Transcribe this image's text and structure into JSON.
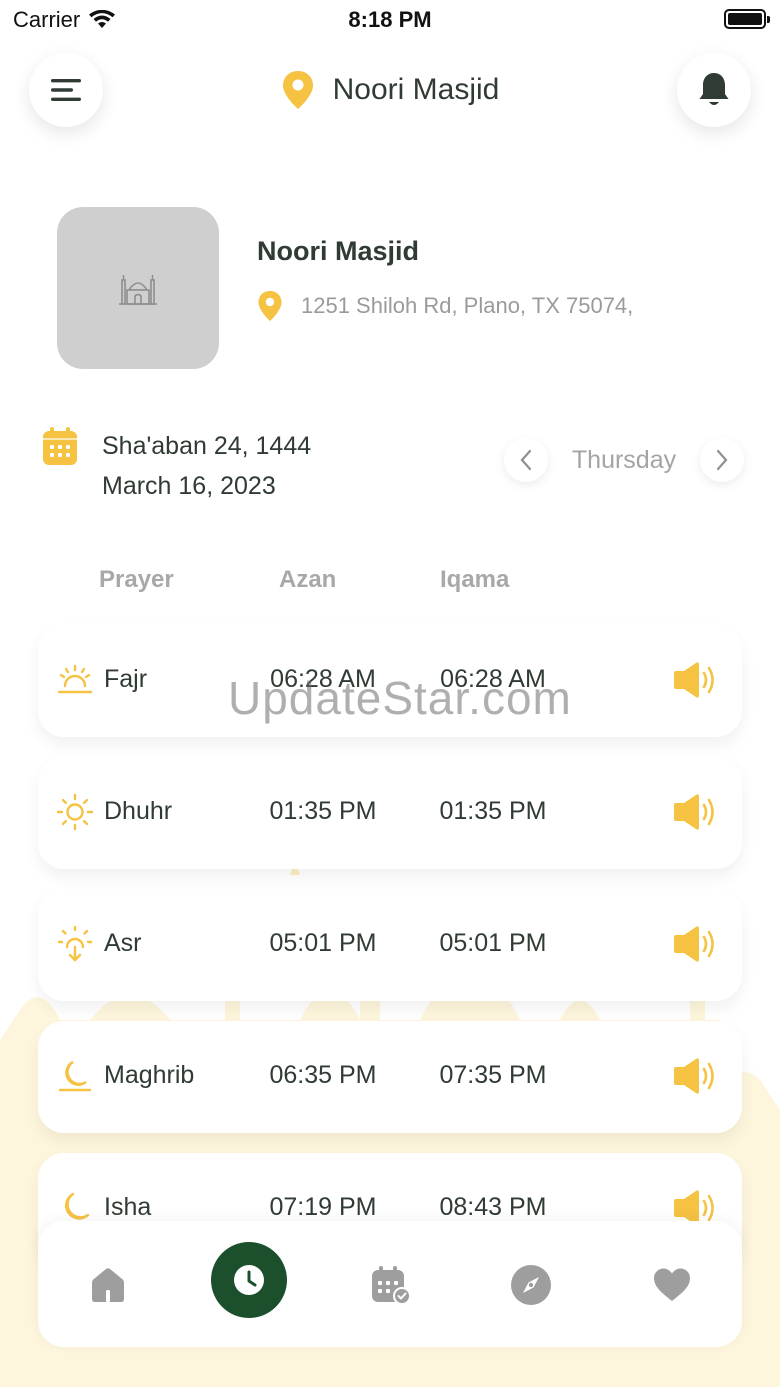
{
  "status_bar": {
    "carrier": "Carrier",
    "time": "8:18 PM"
  },
  "header": {
    "title": "Noori Masjid"
  },
  "masjid": {
    "name": "Noori Masjid",
    "address": "1251 Shiloh Rd, Plano, TX 75074,"
  },
  "date": {
    "hijri": "Sha'aban 24, 1444",
    "gregorian": "March 16, 2023",
    "day": "Thursday"
  },
  "table": {
    "col_prayer": "Prayer",
    "col_azan": "Azan",
    "col_iqama": "Iqama"
  },
  "prayers": [
    {
      "name": "Fajr",
      "azan": "06:28 AM",
      "iqama": "06:28 AM",
      "icon": "sunrise-icon"
    },
    {
      "name": "Dhuhr",
      "azan": "01:35 PM",
      "iqama": "01:35 PM",
      "icon": "sun-icon"
    },
    {
      "name": "Asr",
      "azan": "05:01 PM",
      "iqama": "05:01 PM",
      "icon": "sun-down-icon"
    },
    {
      "name": "Maghrib",
      "azan": "06:35 PM",
      "iqama": "07:35 PM",
      "icon": "sunset-moon-icon"
    },
    {
      "name": "Isha",
      "azan": "07:19 PM",
      "iqama": "08:43 PM",
      "icon": "moon-icon"
    }
  ],
  "watermark": "UpdateStar.com",
  "nav": [
    "home-icon",
    "clock-icon",
    "calendar-check-icon",
    "compass-icon",
    "heart-icon"
  ],
  "colors": {
    "accent": "#f5c242",
    "primary": "#1c4f2c",
    "text": "#2f3b33",
    "muted": "#a8a8a8"
  }
}
